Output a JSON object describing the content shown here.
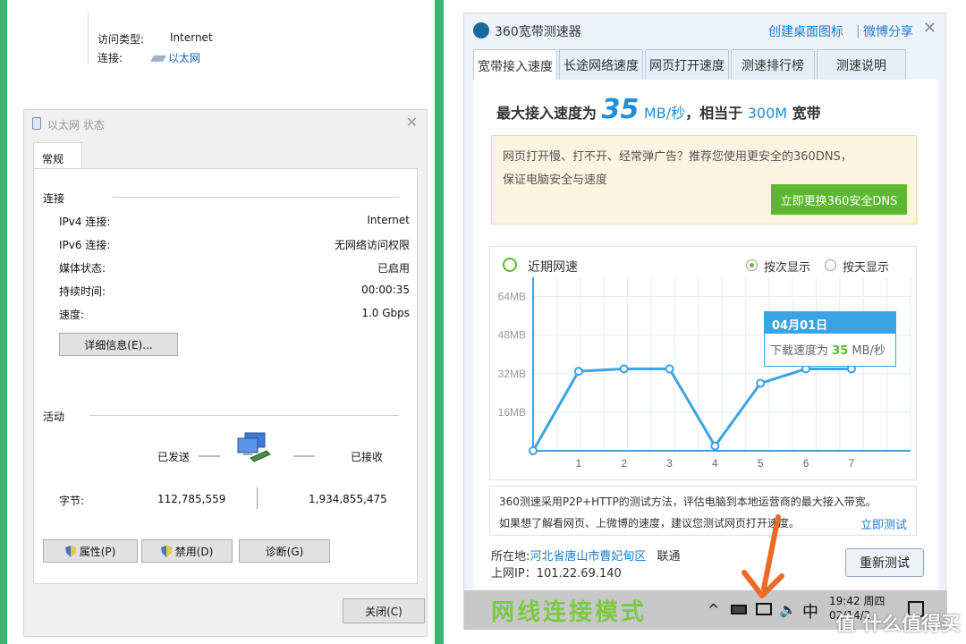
{
  "left_top": {
    "access_type_label": "访问类型:",
    "access_type_value": "Internet",
    "connection_label": "连接:",
    "connection_value": "以太网"
  },
  "status_dialog": {
    "title": "以太网 状态",
    "tab": "常规",
    "connection_section": "连接",
    "rows": [
      {
        "label": "IPv4 连接:",
        "value": "Internet"
      },
      {
        "label": "IPv6 连接:",
        "value": "无网络访问权限"
      },
      {
        "label": "媒体状态:",
        "value": "已启用"
      },
      {
        "label": "持续时间:",
        "value": "00:00:35"
      },
      {
        "label": "速度:",
        "value": "1.0 Gbps"
      }
    ],
    "details_button": "详细信息(E)...",
    "activity_section": "活动",
    "sent_label": "已发送",
    "received_label": "已接收",
    "bytes_label": "字节:",
    "bytes_sent": "112,785,559",
    "bytes_received": "1,934,855,475",
    "properties_button": "属性(P)",
    "disable_button": "禁用(D)",
    "diagnose_button": "诊断(G)",
    "close_button": "关闭(C)"
  },
  "speed_app": {
    "title": "360宽带测速器",
    "create_icon_link": "创建桌面图标",
    "share_link": "微博分享",
    "tabs": [
      "宽带接入速度",
      "长途网络速度",
      "网页打开速度",
      "测速排行榜",
      "测速说明"
    ],
    "speed_prefix": "最大接入速度为",
    "speed_value": "35",
    "speed_unit": "MB/秒",
    "equiv_prefix": "，相当于",
    "equiv_value": "300M",
    "equiv_suffix": "宽带",
    "notice_line1": "网页打开慢、打不开、经常弹广告？推荐您使用更安全的360DNS，",
    "notice_line2": "保证电脑安全与速度",
    "notice_button": "立即更换360安全DNS",
    "chart_title": "近期网速",
    "radio_by_count": "按次显示",
    "radio_by_day": "按天显示",
    "tooltip_date": "04月01日",
    "tooltip_prefix": "下载速度为",
    "tooltip_value": "35",
    "tooltip_unit": "MB/秒",
    "info_line1": "360测速采用P2P+HTTP的测试方法，评估电脑到本地运营商的最大接入带宽。",
    "info_line2": "如果想了解看网页、上微博的速度，建议您测试网页打开速度。",
    "info_link": "立即测试",
    "location_label": "所在地:",
    "location_value": "河北省唐山市曹妃甸区",
    "isp": "联通",
    "ip_label": "上网IP：",
    "ip_value": "101.22.69.140",
    "retest_button": "重新测试"
  },
  "taskbar": {
    "mode_text": "网线连接模式",
    "ime": "中",
    "time": "19:42 周四",
    "date": "02/14/2"
  },
  "watermark": "值 什么值得买",
  "colors": {
    "background_green": "#3cb371",
    "accent_blue": "#1f8ed6",
    "accent_green": "#5cb832",
    "arrow_orange": "#f06a24"
  },
  "chart_data": {
    "type": "line",
    "x": [
      1,
      2,
      3,
      4,
      5,
      6,
      7
    ],
    "y": [
      33,
      34,
      34,
      2,
      28,
      34,
      34
    ],
    "ytick_labels": [
      "16MB",
      "32MB",
      "48MB",
      "64MB"
    ],
    "yticks": [
      16,
      32,
      48,
      64
    ],
    "ylim": [
      0,
      72
    ],
    "xlim": [
      0,
      8.3
    ],
    "grid": true
  }
}
